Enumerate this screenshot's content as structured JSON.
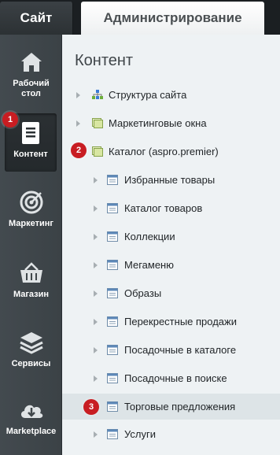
{
  "top_tabs": {
    "site": "Сайт",
    "admin": "Администрирование"
  },
  "sidebar": {
    "items": [
      {
        "label": "Рабочий стол",
        "icon": "home-icon"
      },
      {
        "label": "Контент",
        "icon": "document-icon"
      },
      {
        "label": "Маркетинг",
        "icon": "target-icon"
      },
      {
        "label": "Магазин",
        "icon": "basket-icon"
      },
      {
        "label": "Сервисы",
        "icon": "layers-icon"
      },
      {
        "label": "Marketplace",
        "icon": "cloud-download-icon"
      }
    ]
  },
  "main": {
    "title": "Контент",
    "tree": [
      {
        "label": "Структура сайта"
      },
      {
        "label": "Маркетинговые окна"
      },
      {
        "label": "Каталог (aspro.premier)"
      },
      {
        "label": "Избранные товары"
      },
      {
        "label": "Каталог товаров"
      },
      {
        "label": "Коллекции"
      },
      {
        "label": "Мегаменю"
      },
      {
        "label": "Образы"
      },
      {
        "label": "Перекрестные продажи"
      },
      {
        "label": "Посадочные в каталоге"
      },
      {
        "label": "Посадочные в поиске"
      },
      {
        "label": "Торговые предложения"
      },
      {
        "label": "Услуги"
      }
    ]
  },
  "badges": {
    "b1": "1",
    "b2": "2",
    "b3": "3"
  },
  "colors": {
    "badge": "#c81d22",
    "sidebar": "#3f464a",
    "panel": "#eef2f4"
  }
}
